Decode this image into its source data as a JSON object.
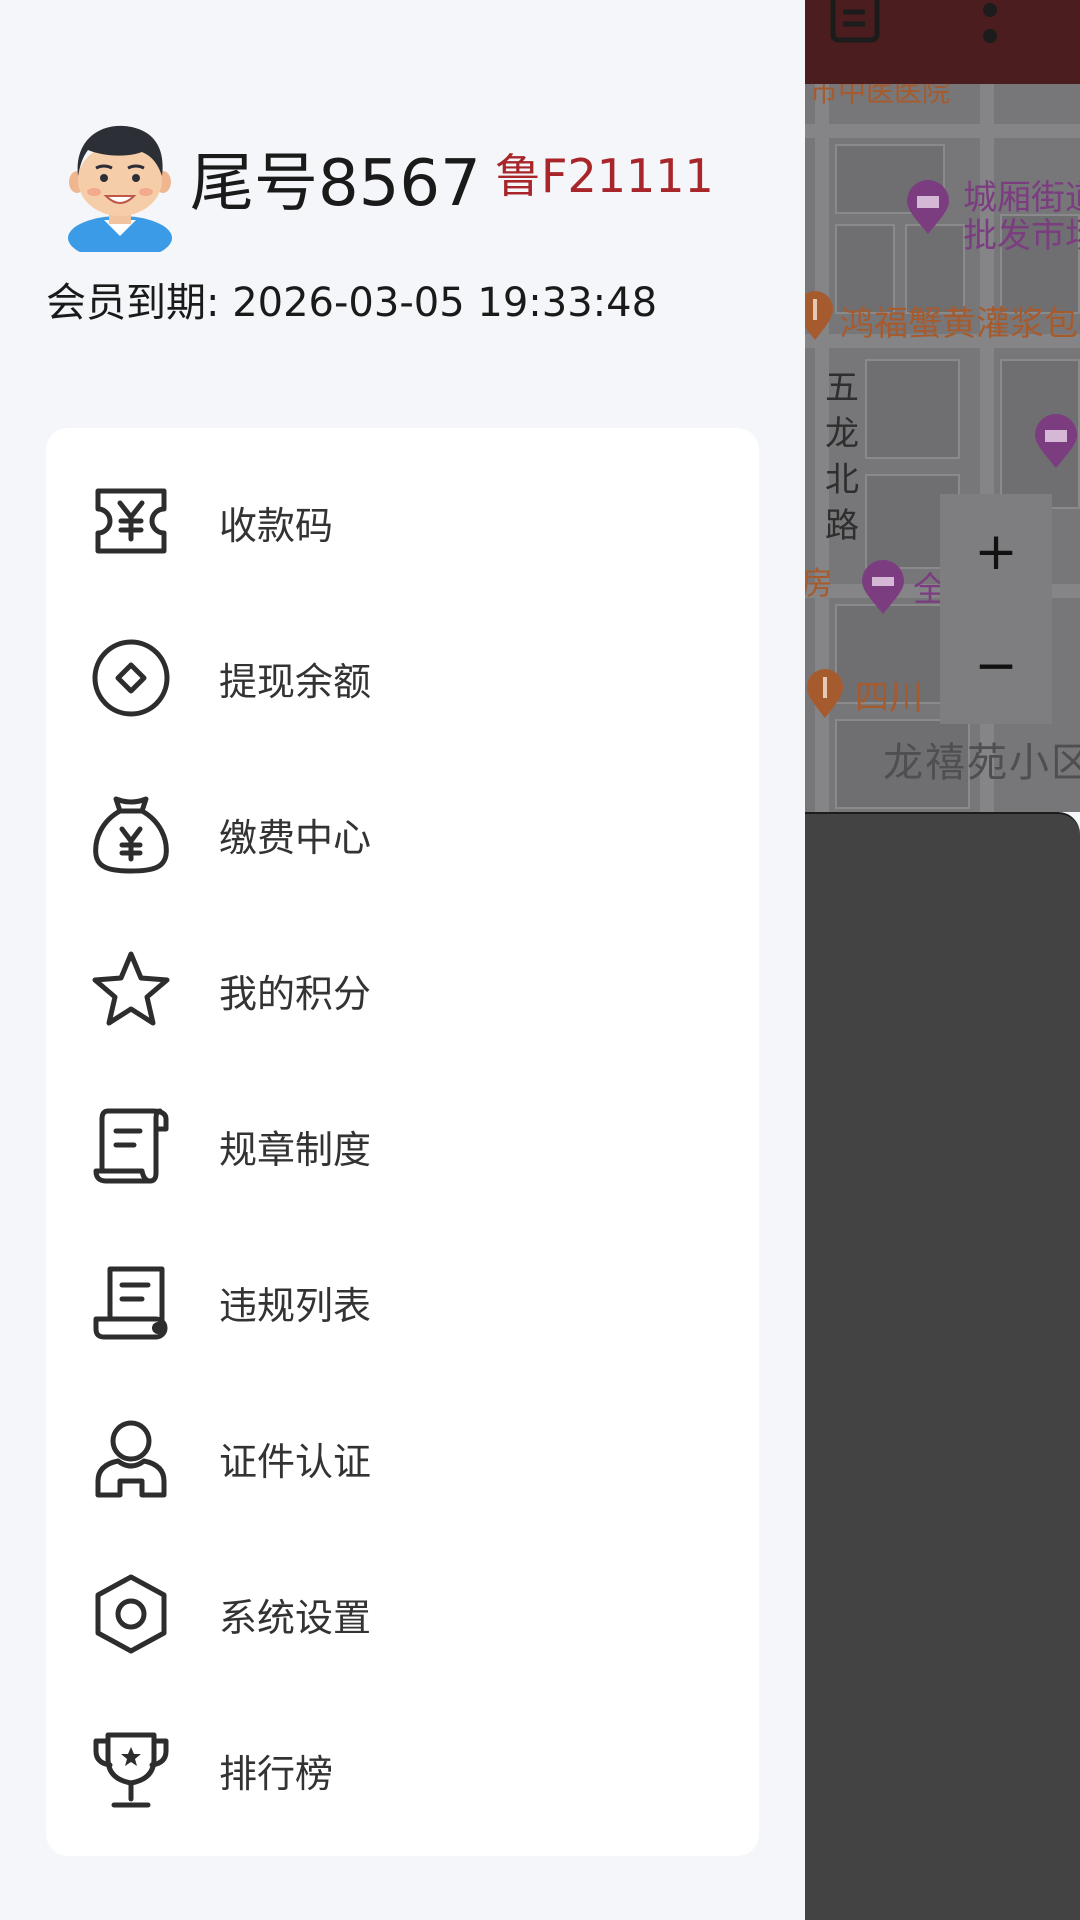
{
  "profile": {
    "username": "尾号8567",
    "plate": "鲁F21111",
    "membership_expiry": "会员到期: 2026-03-05 19:33:48"
  },
  "menu": [
    {
      "label": "收款码",
      "icon": "ticket-yuan-icon"
    },
    {
      "label": "提现余额",
      "icon": "diamond-coin-icon"
    },
    {
      "label": "缴费中心",
      "icon": "money-bag-icon"
    },
    {
      "label": "我的积分",
      "icon": "star-icon"
    },
    {
      "label": "规章制度",
      "icon": "scroll-icon"
    },
    {
      "label": "违规列表",
      "icon": "document-list-icon"
    },
    {
      "label": "证件认证",
      "icon": "person-icon"
    },
    {
      "label": "系统设置",
      "icon": "hex-nut-settings-icon"
    },
    {
      "label": "排行榜",
      "icon": "trophy-icon"
    }
  ],
  "background_map": {
    "labels": {
      "hospital": "市中医医院",
      "market_1": "城厢街道",
      "market_2": "批发市场",
      "restaurant": "鸿福蟹黄灌浆包",
      "road": [
        "五",
        "龙",
        "北",
        "路"
      ],
      "left_cut": "房",
      "hotel": "全",
      "sichuan": "四川",
      "community": "龙禧苑小区"
    },
    "zoom_in": "+",
    "zoom_out": "−"
  },
  "colors": {
    "plate": "#a8252a",
    "toolbar": "#4b1d1e",
    "poi_purple": "#7b3d80",
    "poi_orange": "#a65b2e"
  }
}
